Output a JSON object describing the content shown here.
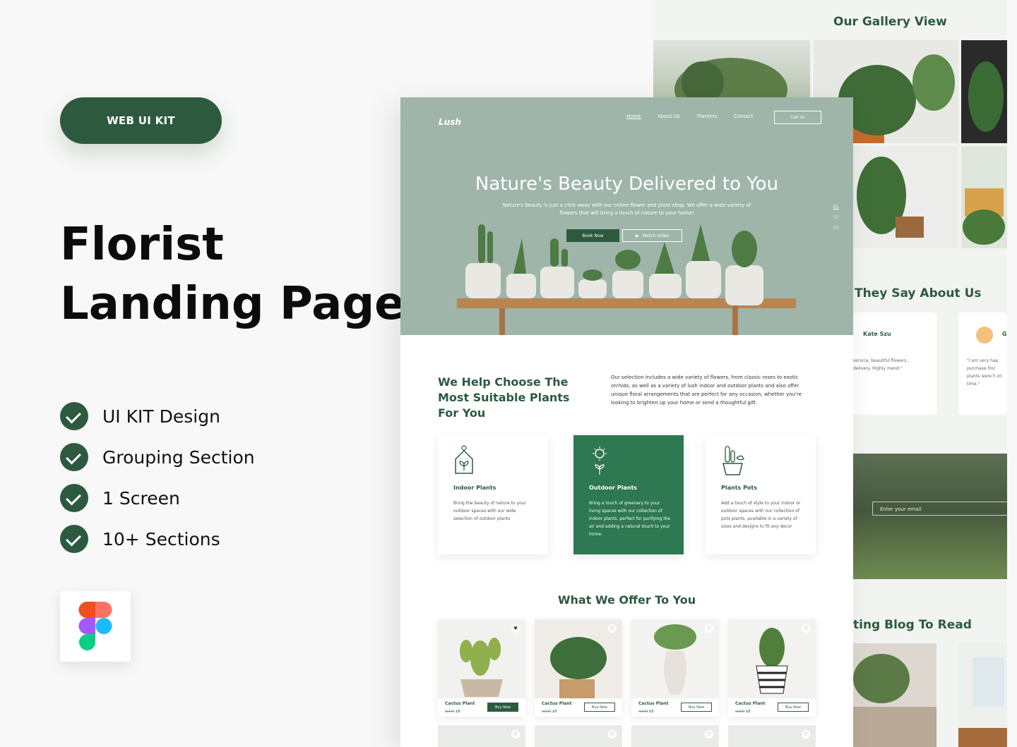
{
  "promo": {
    "badge": "WEB UI KIT",
    "title_line1": "Florist",
    "title_line2": "Landing Page",
    "features": [
      "UI KIT Design",
      "Grouping Section",
      "1 Screen",
      "10+ Sections"
    ]
  },
  "back": {
    "gallery_title": "Our Gallery View",
    "testimonials_title": "They Say About Us",
    "testimonial1_name": "Kate Szu",
    "testimonial1_text": "service, beautiful flowers, delivery. Highly mend.\"",
    "testimonial2_name": "G",
    "testimonial2_text": "\"I am very hap purchase fror plants were h on time.\"",
    "newsletter_placeholder": "Enter your email",
    "blog_title": "ting Blog To Read"
  },
  "front": {
    "logo": "Lush",
    "nav": {
      "home": "Home",
      "about": "About Us",
      "planters": "Planters",
      "contact": "Contact",
      "call": "Call Us"
    },
    "hero_title": "Nature's Beauty Delivered to You",
    "hero_sub": "Nature's beauty is just a click away with our online flower and plant shop. We offer a wide variety of flowers that will bring a touch of nature to your home!",
    "book_now": "Book Now",
    "watch_video": "Watch Video",
    "slides": [
      "01",
      "02",
      "03"
    ],
    "about_title": "We Help Choose The Most Suitable Plants For You",
    "about_text": "Our selection includes a wide variety of flowers, from classic roses to exotic orchids, as well as a variety of lush indoor and outdoor plants and also offer unique floral arrangements that are perfect for any occasion, whether you're looking to brighten up your home or send a thoughtful gift.",
    "cards": [
      {
        "title": "Indoor Plants",
        "text": "Bring the beauty of nature to your outdoor spaces with our wide selection of outdoor plants"
      },
      {
        "title": "Outdoor Plants",
        "text": "Bring a touch of greenery to your living spaces with our collection of indoor plants, perfect for purifying the air and adding a natural touch to your home."
      },
      {
        "title": "Plants Pots",
        "text": "Add a touch of style to your indoor or outdoor spaces with our collection of pots plants, available in a variety of sizes and designs to fit any decor"
      }
    ],
    "offer_title": "What We Offer To You",
    "products": [
      {
        "name": "Cactus Plant",
        "old": "($10)",
        "price": "$8",
        "buy": "Buy Now"
      },
      {
        "name": "Cactus Plant",
        "old": "($10)",
        "price": "$8",
        "buy": "Buy Now"
      },
      {
        "name": "Cactus Plant",
        "old": "($10)",
        "price": "$8",
        "buy": "Buy Now"
      },
      {
        "name": "Cactus Plant",
        "old": "($10)",
        "price": "$8",
        "buy": "Buy Now"
      }
    ]
  },
  "colors": {
    "brand": "#2d5a3f",
    "hero": "#9fb5aa",
    "active_card": "#2e7852"
  }
}
